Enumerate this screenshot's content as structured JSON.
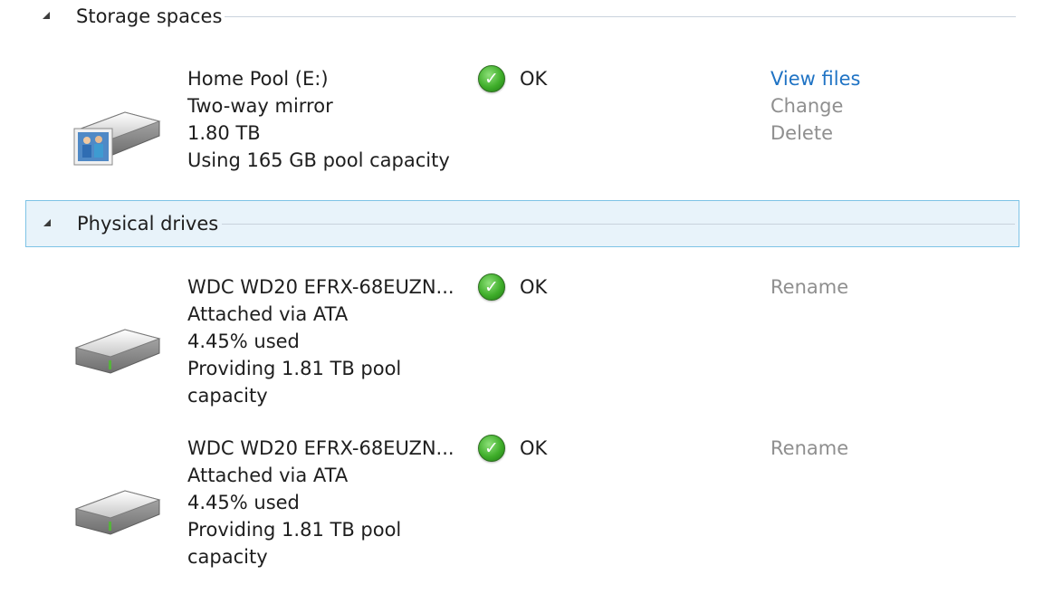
{
  "storage_spaces": {
    "header": "Storage spaces",
    "space": {
      "name": "Home Pool (E:)",
      "resiliency": "Two-way mirror",
      "size": "1.80 TB",
      "usage": "Using 165 GB pool capacity",
      "status": "OK",
      "actions": {
        "view_files": "View files",
        "change": "Change",
        "delete": "Delete"
      }
    }
  },
  "physical_drives": {
    "header": "Physical drives",
    "drives": [
      {
        "name": "WDC WD20 EFRX-68EUZN...",
        "connection": "Attached via ATA",
        "used": "4.45% used",
        "providing_line1": "Providing 1.81 TB pool",
        "providing_line2": "capacity",
        "status": "OK",
        "rename": "Rename"
      },
      {
        "name": "WDC WD20 EFRX-68EUZN...",
        "connection": "Attached via ATA",
        "used": "4.45% used",
        "providing_line1": "Providing 1.81 TB pool",
        "providing_line2": "capacity",
        "status": "OK",
        "rename": "Rename"
      }
    ]
  },
  "colors": {
    "link": "#1f73c4",
    "disabled": "#8f8f8f",
    "selected_bg": "#e8f3fa",
    "selected_border": "#7ec3e6",
    "status_ok": "#3fae2a"
  },
  "icons": {
    "collapse": "triangle-collapse-icon",
    "status": "green-check-icon",
    "space_drive": "storage-space-drive-icon",
    "hdd": "hard-drive-icon"
  }
}
